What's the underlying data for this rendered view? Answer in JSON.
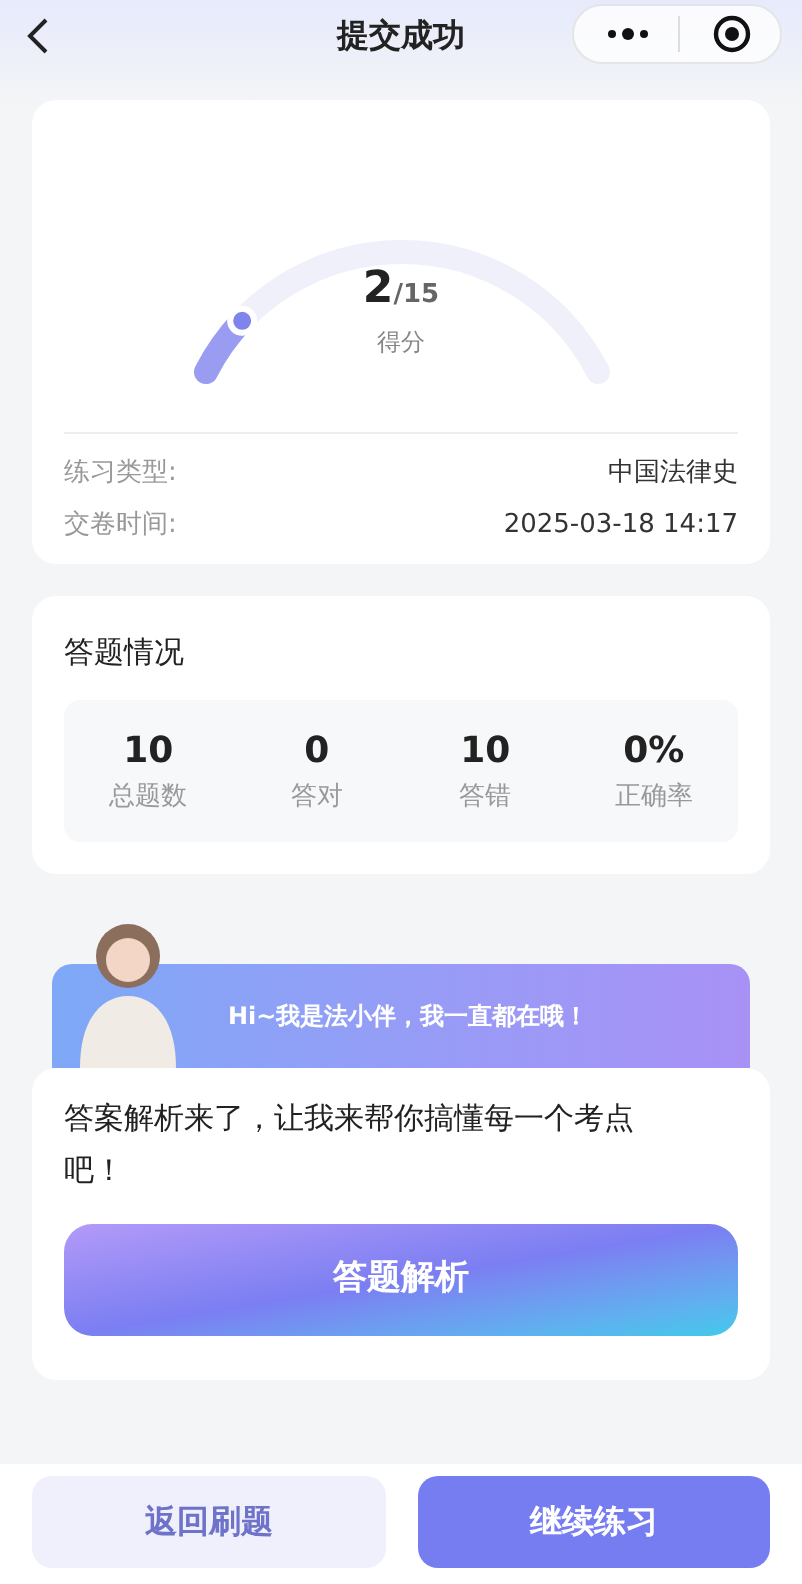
{
  "nav": {
    "title": "提交成功"
  },
  "score": {
    "value": "2",
    "total": "/15",
    "label": "得分",
    "level": 0.13
  },
  "details": [
    {
      "label": "练习类型:",
      "value": "中国法律史"
    },
    {
      "label": "交卷时间:",
      "value": "2025-03-18 14:17"
    }
  ],
  "summary": {
    "title": "答题情况",
    "stats": [
      {
        "value": "10",
        "label": "总题数"
      },
      {
        "value": "0",
        "label": "答对"
      },
      {
        "value": "10",
        "label": "答错"
      },
      {
        "value": "0%",
        "label": "正确率"
      }
    ]
  },
  "assistant": {
    "greeting": "Hi~我是法小伴，我一直都在哦！",
    "message": "答案解析来了，让我来帮你搞懂每一个考点吧！",
    "button": "答题解析"
  },
  "footer": [
    {
      "label": "返回刷题",
      "kind": "secondary"
    },
    {
      "label": "继续练习",
      "kind": "primary"
    }
  ]
}
